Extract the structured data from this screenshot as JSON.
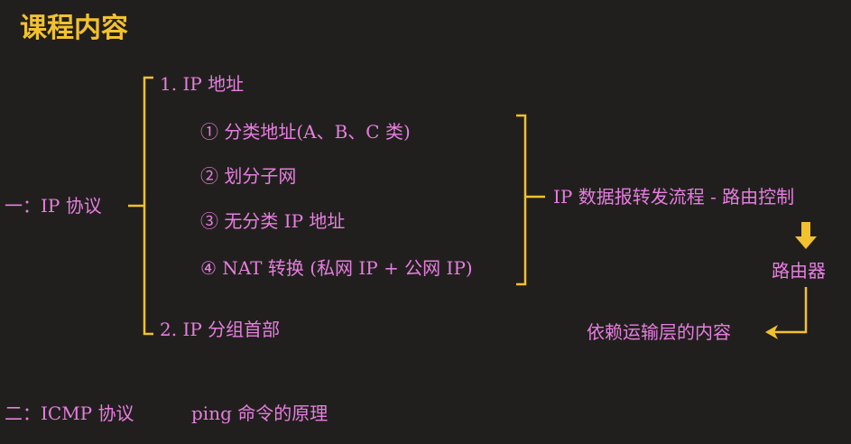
{
  "title": "课程内容",
  "colors": {
    "background": "#211f1d",
    "accent": "#f2c12e",
    "text": "#e67ee0"
  },
  "part1": {
    "label": "一：IP 协议",
    "section1": "1. IP 地址",
    "items": [
      "① 分类地址(A、B、C 类)",
      "② 划分子网",
      "③ 无分类 IP 地址",
      "④ NAT 转换 (私网 IP + 公网 IP)"
    ],
    "section2": "2. IP 分组首部"
  },
  "flow": {
    "forwarding": "IP 数据报转发流程 - 路由控制",
    "router": "路由器",
    "transport": "依赖运输层的内容"
  },
  "part2": {
    "label": "二：ICMP 协议",
    "note": "ping 命令的原理"
  }
}
